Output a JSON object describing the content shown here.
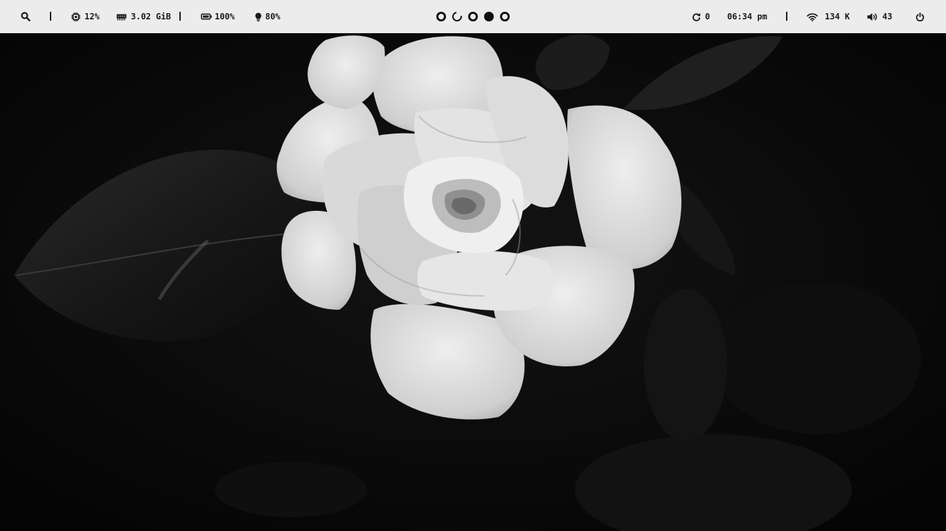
{
  "topbar": {
    "left": {
      "search_icon": "search-icon",
      "cpu": {
        "icon": "cpu-chip-icon",
        "value": "12%"
      },
      "memory": {
        "icon": "memory-icon",
        "value": "3.02 GiB"
      },
      "battery": {
        "icon": "battery-icon",
        "value": "100%"
      },
      "brightness": {
        "icon": "lightbulb-icon",
        "value": "80%"
      }
    },
    "workspaces": [
      {
        "name": "workspace-1",
        "state": "occupied"
      },
      {
        "name": "workspace-2",
        "state": "empty"
      },
      {
        "name": "workspace-3",
        "state": "occupied"
      },
      {
        "name": "workspace-4",
        "state": "focused"
      },
      {
        "name": "workspace-5",
        "state": "occupied"
      }
    ],
    "right": {
      "updates": {
        "icon": "refresh-icon",
        "value": "0"
      },
      "clock": "06:34 pm",
      "network": {
        "icon": "wifi-icon",
        "value": "134 K"
      },
      "volume": {
        "icon": "volume-icon",
        "value": "43"
      },
      "power_icon": "power-icon"
    }
  },
  "wallpaper": {
    "subject": "rose-image",
    "palette": [
      "#060606",
      "#2b2b2b",
      "#bdbdbd",
      "#ededed"
    ]
  }
}
